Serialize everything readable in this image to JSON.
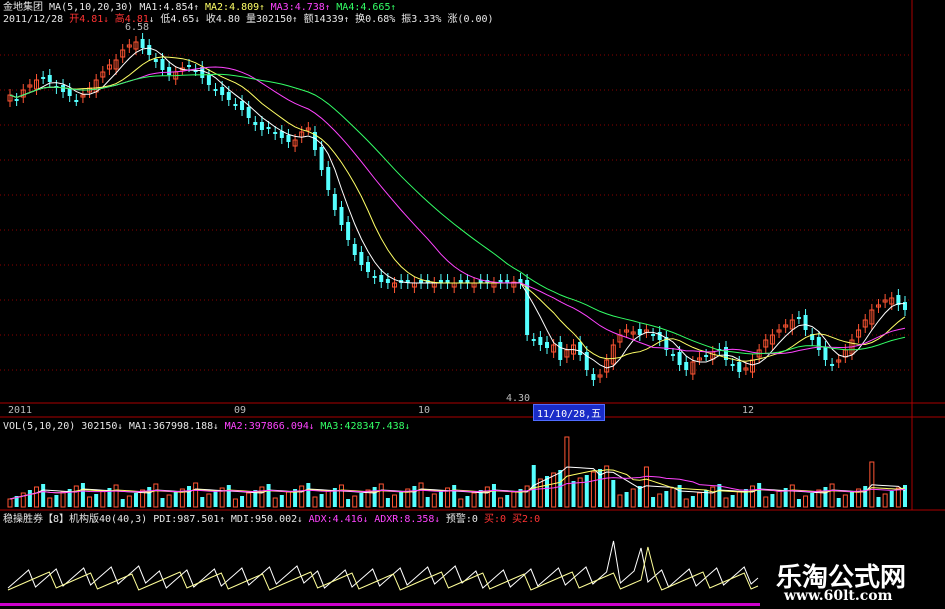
{
  "stock": {
    "name": "金地集团",
    "ma_label": "MA(5,10,20,30)",
    "ma1": "MA1:4.854",
    "ma2": "MA2:4.809",
    "ma3": "MA3:4.738",
    "ma4": "MA4:4.665",
    "date": "2011/12/28",
    "open": "开4.81",
    "high": "高4.81",
    "low": "低4.65",
    "close": "收4.80",
    "volume": "量302150",
    "amount": "额14339",
    "turnover": "换0.68%",
    "amplitude": "振3.33%",
    "change": "涨(0.00)"
  },
  "price_labels": {
    "high_mark": "6.58",
    "low_mark": "4.30"
  },
  "time_axis": {
    "labels": [
      "2011",
      "09",
      "10",
      "12"
    ],
    "cursor_date": "11/10/28,五"
  },
  "volume_panel": {
    "label": "VOL(5,10,20)",
    "value": "302150",
    "ma1": "MA1:367998.188",
    "ma2": "MA2:397866.094",
    "ma3": "MA3:428347.438"
  },
  "indicator_panel": {
    "name": "稳操胜券【8】机构版40(40,3)",
    "pdi": "PDI:987.501",
    "mdi": "MDI:950.002",
    "adx": "ADX:4.416",
    "adxr": "ADXR:8.358",
    "alert": "预警:0",
    "buy": "买:0",
    "buy2": "买2:0"
  },
  "watermark": {
    "title": "乐淘公式网",
    "url": "www.60lt.com"
  },
  "colors": {
    "background": "#000000",
    "up_candle": "#ff5533",
    "down_candle": "#55ffff",
    "ma1": "#ffffff",
    "ma2": "#ffff66",
    "ma3": "#ff44ff",
    "ma4": "#33ff66",
    "grid": "#8b0000"
  }
}
